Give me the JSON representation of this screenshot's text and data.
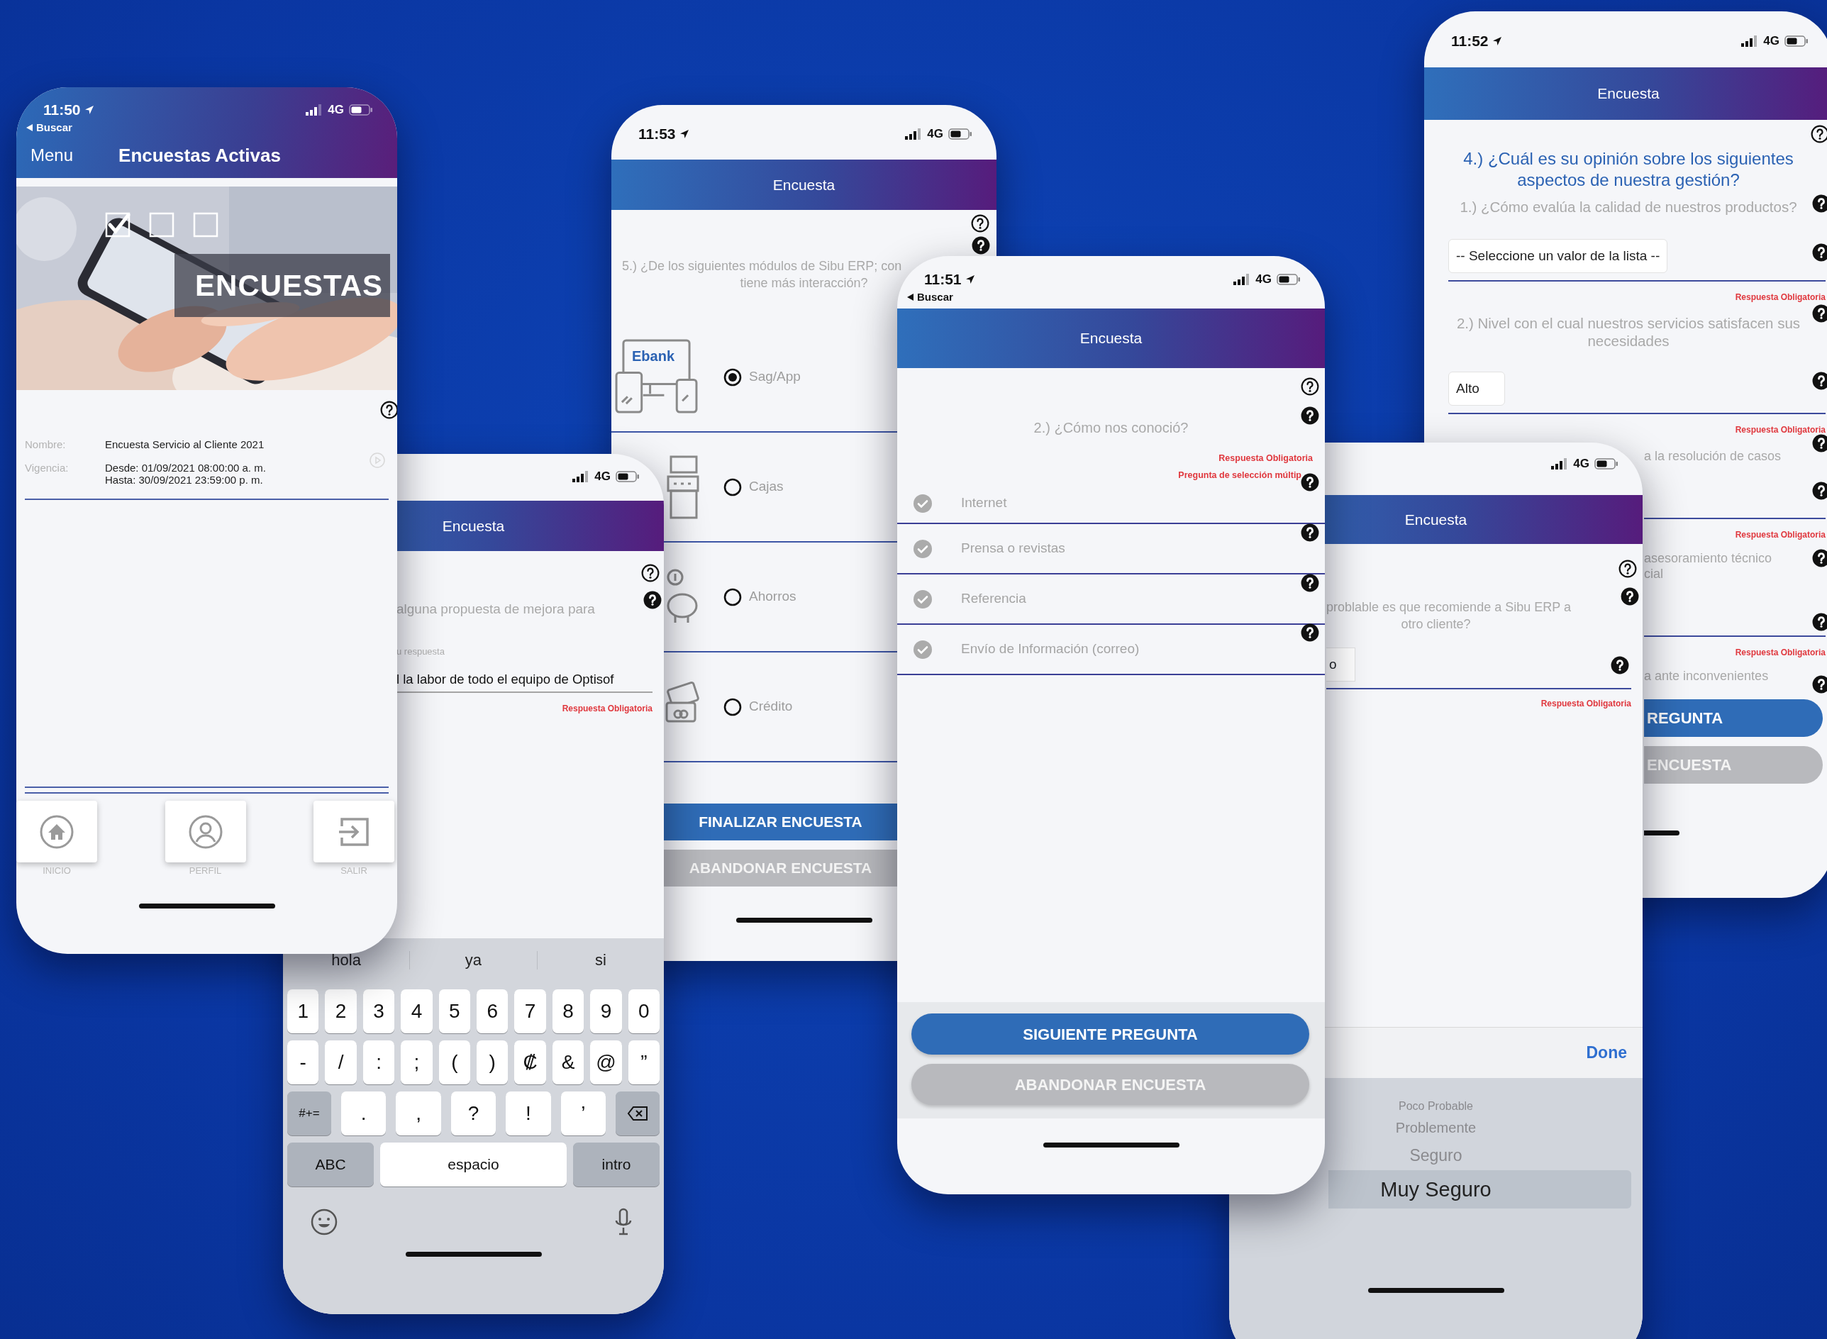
{
  "home_screen": {
    "status": {
      "time": "11:50",
      "back": "Buscar",
      "network": "4G"
    },
    "menu_button": "Menu",
    "title": "Encuestas Activas",
    "banner_checks": [
      {
        "checked": true
      },
      {
        "checked": false
      },
      {
        "checked": false
      }
    ],
    "banner_title": "ENCUESTAS",
    "details": [
      {
        "label": "Nombre:",
        "lines": [
          "Encuesta Servicio al Cliente 2021"
        ]
      },
      {
        "label": "Vigencia:",
        "lines": [
          "Desde: 01/09/2021 08:00:00 a. m.",
          "Hasta: 30/09/2021 23:59:00 p. m."
        ]
      }
    ],
    "nav": [
      {
        "kind": "home",
        "label": "INICIO"
      },
      {
        "kind": "profile",
        "label": "PERFIL"
      },
      {
        "kind": "exit",
        "label": "SALIR"
      }
    ]
  },
  "text_question_screen": {
    "status": {
      "network": "4G"
    },
    "title": "Encuesta",
    "question": "alguna propuesta de mejora para",
    "answer_label": "u respuesta",
    "answer": "l la labor de todo el equipo de Optisof",
    "required_note": "Respuesta Obligatoria",
    "keyboard": {
      "suggestions": [
        "hola",
        "ya",
        "si"
      ],
      "number_keys": [
        {
          "kind": "char",
          "label": "1"
        },
        {
          "kind": "char",
          "label": "2"
        },
        {
          "kind": "char",
          "label": "3"
        },
        {
          "kind": "char",
          "label": "4"
        },
        {
          "kind": "char",
          "label": "5"
        },
        {
          "kind": "char",
          "label": "6"
        },
        {
          "kind": "char",
          "label": "7"
        },
        {
          "kind": "char",
          "label": "8"
        },
        {
          "kind": "char",
          "label": "9"
        },
        {
          "kind": "char",
          "label": "0"
        }
      ],
      "symbol_keys": [
        {
          "kind": "char",
          "label": "-"
        },
        {
          "kind": "char",
          "label": "/"
        },
        {
          "kind": "char",
          "label": ":"
        },
        {
          "kind": "char",
          "label": ";"
        },
        {
          "kind": "char",
          "label": "("
        },
        {
          "kind": "char",
          "label": ")"
        },
        {
          "kind": "char",
          "label": "₡"
        },
        {
          "kind": "char",
          "label": "&"
        },
        {
          "kind": "char",
          "label": "@"
        },
        {
          "kind": "char",
          "label": "”"
        }
      ],
      "punctuation_keys": [
        {
          "kind": "special",
          "label": "#+="
        },
        {
          "kind": "char",
          "label": "."
        },
        {
          "kind": "char",
          "label": ","
        },
        {
          "kind": "char",
          "label": "?"
        },
        {
          "kind": "char",
          "label": "!"
        },
        {
          "kind": "char",
          "label": "’"
        },
        {
          "kind": "delete"
        }
      ],
      "bottom_keys": [
        {
          "kind": "special",
          "label": "ABC"
        },
        {
          "kind": "space",
          "label": "espacio"
        },
        {
          "kind": "special",
          "label": "intro"
        }
      ]
    }
  },
  "module_question_screen": {
    "status": {
      "time": "11:53",
      "network": "4G"
    },
    "title": "Encuesta",
    "question_lines": [
      "5.) ¿De los siguientes módulos de Sibu ERP; con",
      "tiene más interacción?"
    ],
    "options": [
      {
        "kind": "ebank",
        "logo_text": "Ebank",
        "label": "Sag/App",
        "selected": true
      },
      {
        "kind": "register",
        "label": "Cajas",
        "selected": false
      },
      {
        "kind": "piggy",
        "label": "Ahorros",
        "selected": false
      },
      {
        "kind": "card",
        "label": "Crédito",
        "selected": false
      }
    ],
    "buttons": [
      {
        "kind": "primary",
        "label": "FINALIZAR ENCUESTA"
      },
      {
        "kind": "secondary",
        "label": "ABANDONAR ENCUESTA"
      }
    ]
  },
  "multiple_choice_screen": {
    "status": {
      "time": "11:51",
      "back": "Buscar",
      "network": "4G"
    },
    "title": "Encuesta",
    "question": "2.) ¿Cómo nos conoció?",
    "notes": [
      "Respuesta Obligatoria",
      "Pregunta de selección múltip"
    ],
    "options": [
      {
        "label": "Internet",
        "checked": false
      },
      {
        "label": "Prensa o revistas",
        "checked": false
      },
      {
        "label": "Referencia",
        "checked": false
      },
      {
        "label": "Envío de Información (correo)",
        "checked": false
      }
    ],
    "buttons": [
      {
        "kind": "primary",
        "label": "SIGUIENTE PREGUNTA"
      },
      {
        "kind": "secondary",
        "label": "ABANDONAR ENCUESTA"
      }
    ]
  },
  "opinion_screen": {
    "status": {
      "time": "11:52",
      "network": "4G"
    },
    "title": "Encuesta",
    "heading": "4.) ¿Cuál es su opinión sobre los siguientes aspectos de nuestra gestión?",
    "questions": [
      {
        "question": "1.) ¿Cómo evalúa la calidad de nuestros productos?",
        "value": "-- Seleccione un valor de la lista --",
        "note": "Respuesta Obligatoria"
      },
      {
        "question": "2.) Nivel con el cual nuestros servicios satisfacen sus necesidades",
        "value": "Alto",
        "note": "Respuesta Obligatoria"
      }
    ],
    "cut_questions": [
      {
        "lines": [
          "a la resolución de casos"
        ],
        "note": "Respuesta Obligatoria"
      },
      {
        "lines": [
          "asesoramiento técnico",
          "cial"
        ],
        "note": "Respuesta Obligatoria"
      },
      {
        "lines": [
          "a ante inconvenientes"
        ]
      }
    ],
    "buttons": [
      {
        "kind": "primary",
        "label": "REGUNTA"
      },
      {
        "kind": "secondary",
        "label": "ENCUESTA"
      }
    ]
  },
  "picker_screen": {
    "status": {
      "network": "4G"
    },
    "title": "Encuesta",
    "question_lines": [
      "problable es que recomiende a Sibu ERP a",
      "otro cliente?"
    ],
    "answer": "o",
    "note": "Respuesta Obligatoria",
    "done": "Done",
    "picker": [
      {
        "label": "Poco Probable",
        "selected": false
      },
      {
        "label": "Problemente",
        "selected": false
      },
      {
        "label": "Seguro",
        "selected": false
      },
      {
        "label": "Muy Seguro",
        "selected": true
      }
    ]
  }
}
